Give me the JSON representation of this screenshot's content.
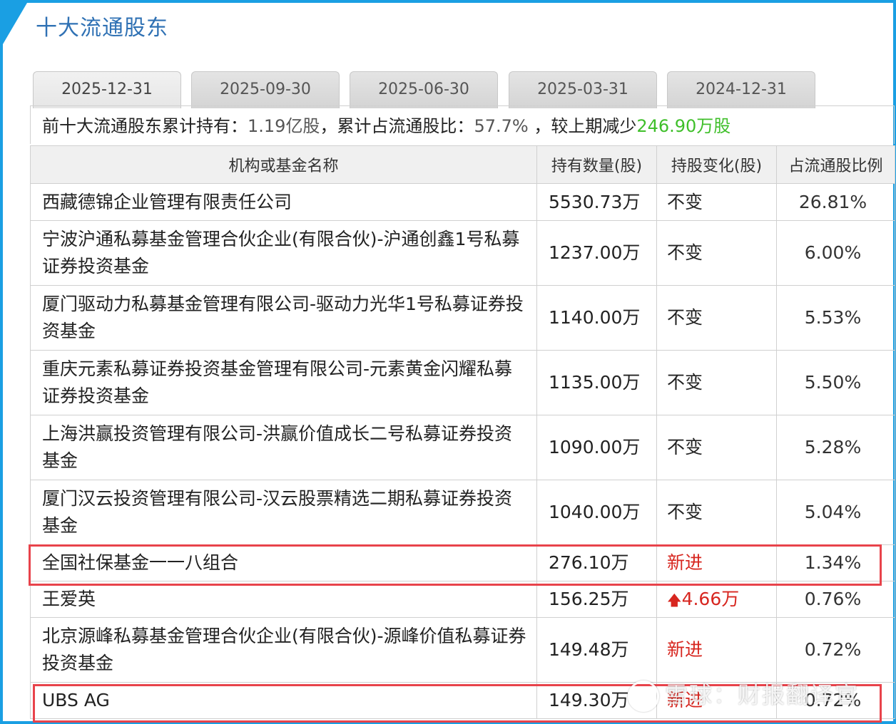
{
  "panel": {
    "title": "十大流通股东"
  },
  "tabs": [
    {
      "label": "2025-12-31",
      "active": true
    },
    {
      "label": "2025-09-30",
      "active": false
    },
    {
      "label": "2025-06-30",
      "active": false
    },
    {
      "label": "2025-03-31",
      "active": false
    },
    {
      "label": "2024-12-31",
      "active": false
    }
  ],
  "summary": {
    "prefix": "前十大流通股东累计持有：",
    "total_shares": "1.19亿股",
    "mid": "，累计占流通股比：",
    "ratio": "57.7%",
    "suffix": " ，较上期减少",
    "decrease": "246.90万股"
  },
  "table": {
    "headers": [
      "机构或基金名称",
      "持有数量(股)",
      "持股变化(股)",
      "占流通股比例"
    ],
    "rows": [
      {
        "name": "西藏德锦企业管理有限责任公司",
        "qty": "5530.73万",
        "change": "不变",
        "ratio": "26.81%"
      },
      {
        "name": "宁波沪通私募基金管理合伙企业(有限合伙)-沪通创鑫1号私募证券投资基金",
        "qty": "1237.00万",
        "change": "不变",
        "ratio": "6.00%"
      },
      {
        "name": "厦门驱动力私募基金管理有限公司-驱动力光华1号私募证券投资基金",
        "qty": "1140.00万",
        "change": "不变",
        "ratio": "5.53%"
      },
      {
        "name": "重庆元素私募证券投资基金管理有限公司-元素黄金闪耀私募证券投资基金",
        "qty": "1135.00万",
        "change": "不变",
        "ratio": "5.50%"
      },
      {
        "name": "上海洪赢投资管理有限公司-洪赢价值成长二号私募证券投资基金",
        "qty": "1090.00万",
        "change": "不变",
        "ratio": "5.28%"
      },
      {
        "name": "厦门汉云投资管理有限公司-汉云股票精选二期私募证券投资基金",
        "qty": "1040.00万",
        "change": "不变",
        "ratio": "5.04%"
      },
      {
        "name": "全国社保基金一一八组合",
        "qty": "276.10万",
        "change": "新进",
        "ratio": "1.34%"
      },
      {
        "name": "王爱英",
        "qty": "156.25万",
        "change": "4.66万",
        "ratio": "0.76%"
      },
      {
        "name": "北京源峰私募基金管理合伙企业(有限合伙)-源峰价值私募证券投资基金",
        "qty": "149.48万",
        "change": "新进",
        "ratio": "0.72%"
      },
      {
        "name": "UBS AG",
        "qty": "149.30万",
        "change": "新进",
        "ratio": "0.72%"
      }
    ]
  },
  "watermark": "雪球：财报翻译官",
  "colors": {
    "frame": "#1a9fe3",
    "title": "#2f71b4",
    "decrease": "#3fbf2a",
    "new_or_up": "#d7261f",
    "highlight_box": "#e8434b"
  },
  "icons": {
    "increase": "up-arrow-icon",
    "watermark_logo": "snowball-logo-icon"
  }
}
